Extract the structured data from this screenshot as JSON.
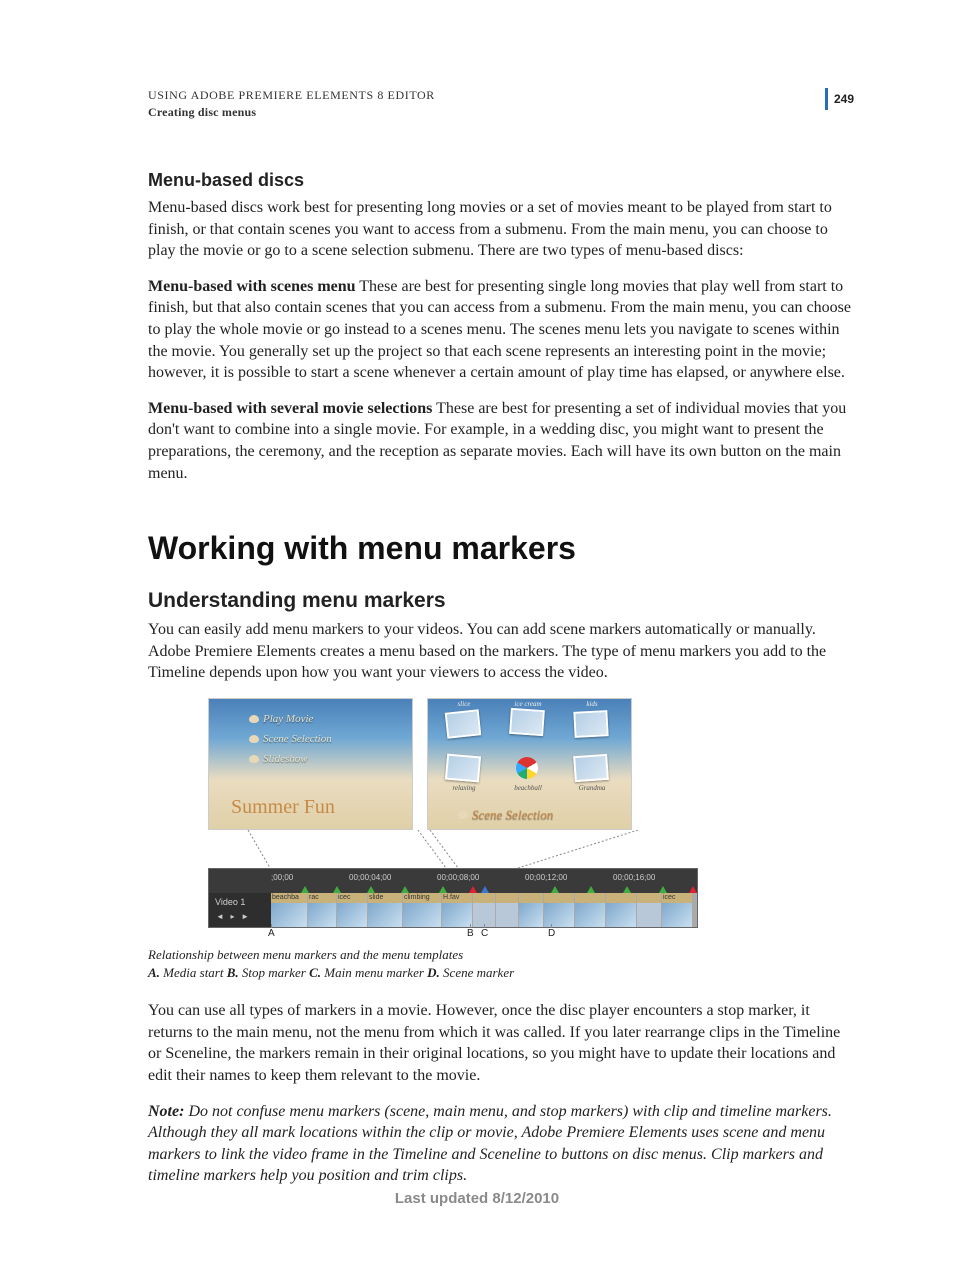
{
  "header": {
    "title": "USING ADOBE PREMIERE ELEMENTS 8 EDITOR",
    "subtitle": "Creating disc menus",
    "page_number": "249"
  },
  "sections": {
    "menu_based_discs": {
      "heading": "Menu-based discs",
      "intro": "Menu-based discs work best for presenting long movies or a set of movies meant to be played from start to finish, or that contain scenes you want to access from a submenu. From the main menu, you can choose to play the movie or go to a scene selection submenu. There are two types of menu-based discs:",
      "scenes_label": "Menu-based with scenes menu",
      "scenes_text": "These are best for presenting single long movies that play well from start to finish, but that also contain scenes that you can access from a submenu. From the main menu, you can choose to play the whole movie or go instead to a scenes menu. The scenes menu lets you navigate to scenes within the movie. You generally set up the project so that each scene represents an interesting point in the movie; however, it is possible to start a scene whenever a certain amount of play time has elapsed, or anywhere else.",
      "several_label": "Menu-based with several movie selections",
      "several_text": "These are best for presenting a set of individual movies that you don't want to combine into a single movie. For example, in a wedding disc, you might want to present the preparations, the ceremony, and the reception as separate movies. Each will have its own button on the main menu."
    },
    "working": {
      "heading": "Working with menu markers"
    },
    "understanding": {
      "heading": "Understanding menu markers",
      "p1": "You can easily add menu markers to your videos. You can add scene markers automatically or manually. Adobe Premiere Elements creates a menu based on the markers. The type of menu markers you add to the Timeline depends upon how you want your viewers to access the video.",
      "p2": "You can use all types of markers in a movie. However, once the disc player encounters a stop marker, it returns to the main menu, not the menu from which it was called. If you later rearrange clips in the Timeline or Sceneline, the markers remain in their original locations, so you might have to update their locations and edit their names to keep them relevant to the movie.",
      "note_label": "Note:",
      "note_text": " Do not confuse menu markers (scene, main menu, and stop markers) with clip and timeline markers. Although they all mark locations within the clip or movie, Adobe Premiere Elements uses scene and menu markers to link the video frame in the Timeline and Sceneline to buttons on disc menus. Clip markers and timeline markers help you position and trim clips."
    }
  },
  "figure": {
    "main_menu": {
      "items": [
        "Play Movie",
        "Scene Selection",
        "Slideshow"
      ],
      "title_script": "Summer Fun"
    },
    "scene_menu": {
      "title_script": "Scene Selection",
      "thumb_labels_top": [
        "slice",
        "ice cream",
        "kids"
      ],
      "thumb_labels_bottom": [
        "relaxing",
        "beachball",
        "Grandma"
      ]
    },
    "timeline": {
      "track_label": "Video 1",
      "timecodes": [
        ";00;00",
        "00;00;04;00",
        "00;00;08;00",
        "00;00;12;00",
        "00;00;16;00"
      ],
      "clip_labels": [
        "beachba",
        "rac",
        "icec",
        "slide",
        "climbing",
        "H.fav",
        "",
        "",
        "",
        "",
        "",
        "",
        "icec"
      ]
    },
    "letters": {
      "A": "A",
      "B": "B",
      "C": "C",
      "D": "D"
    },
    "caption_line1": "Relationship between menu markers and the menu templates",
    "caption_legend": {
      "A_lab": "A.",
      "A_txt": " Media start  ",
      "B_lab": "B.",
      "B_txt": " Stop marker  ",
      "C_lab": "C.",
      "C_txt": " Main menu marker  ",
      "D_lab": "D.",
      "D_txt": " Scene marker"
    }
  },
  "footer": "Last updated 8/12/2010"
}
